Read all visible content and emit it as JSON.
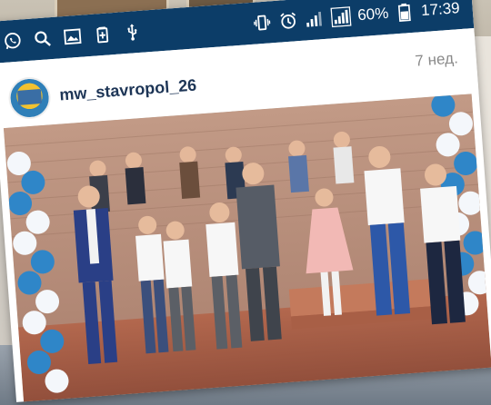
{
  "statusbar": {
    "battery": "60%",
    "clock": "17:39",
    "left_icons": [
      "whatsapp-icon",
      "search-icon",
      "gallery-icon",
      "battery-saver-icon",
      "usb-icon"
    ],
    "right_icons": [
      "vibrate-icon",
      "alarm-icon",
      "signal-icon",
      "signal-icon",
      "battery-icon"
    ]
  },
  "post": {
    "username": "mw_stavropol_26",
    "time_ago": "7 нед."
  },
  "colors": {
    "statusbar": "#0c3d68",
    "username": "#1d3556",
    "balloon_blue": "#2f86c8",
    "balloon_white": "#f4f7fb"
  }
}
